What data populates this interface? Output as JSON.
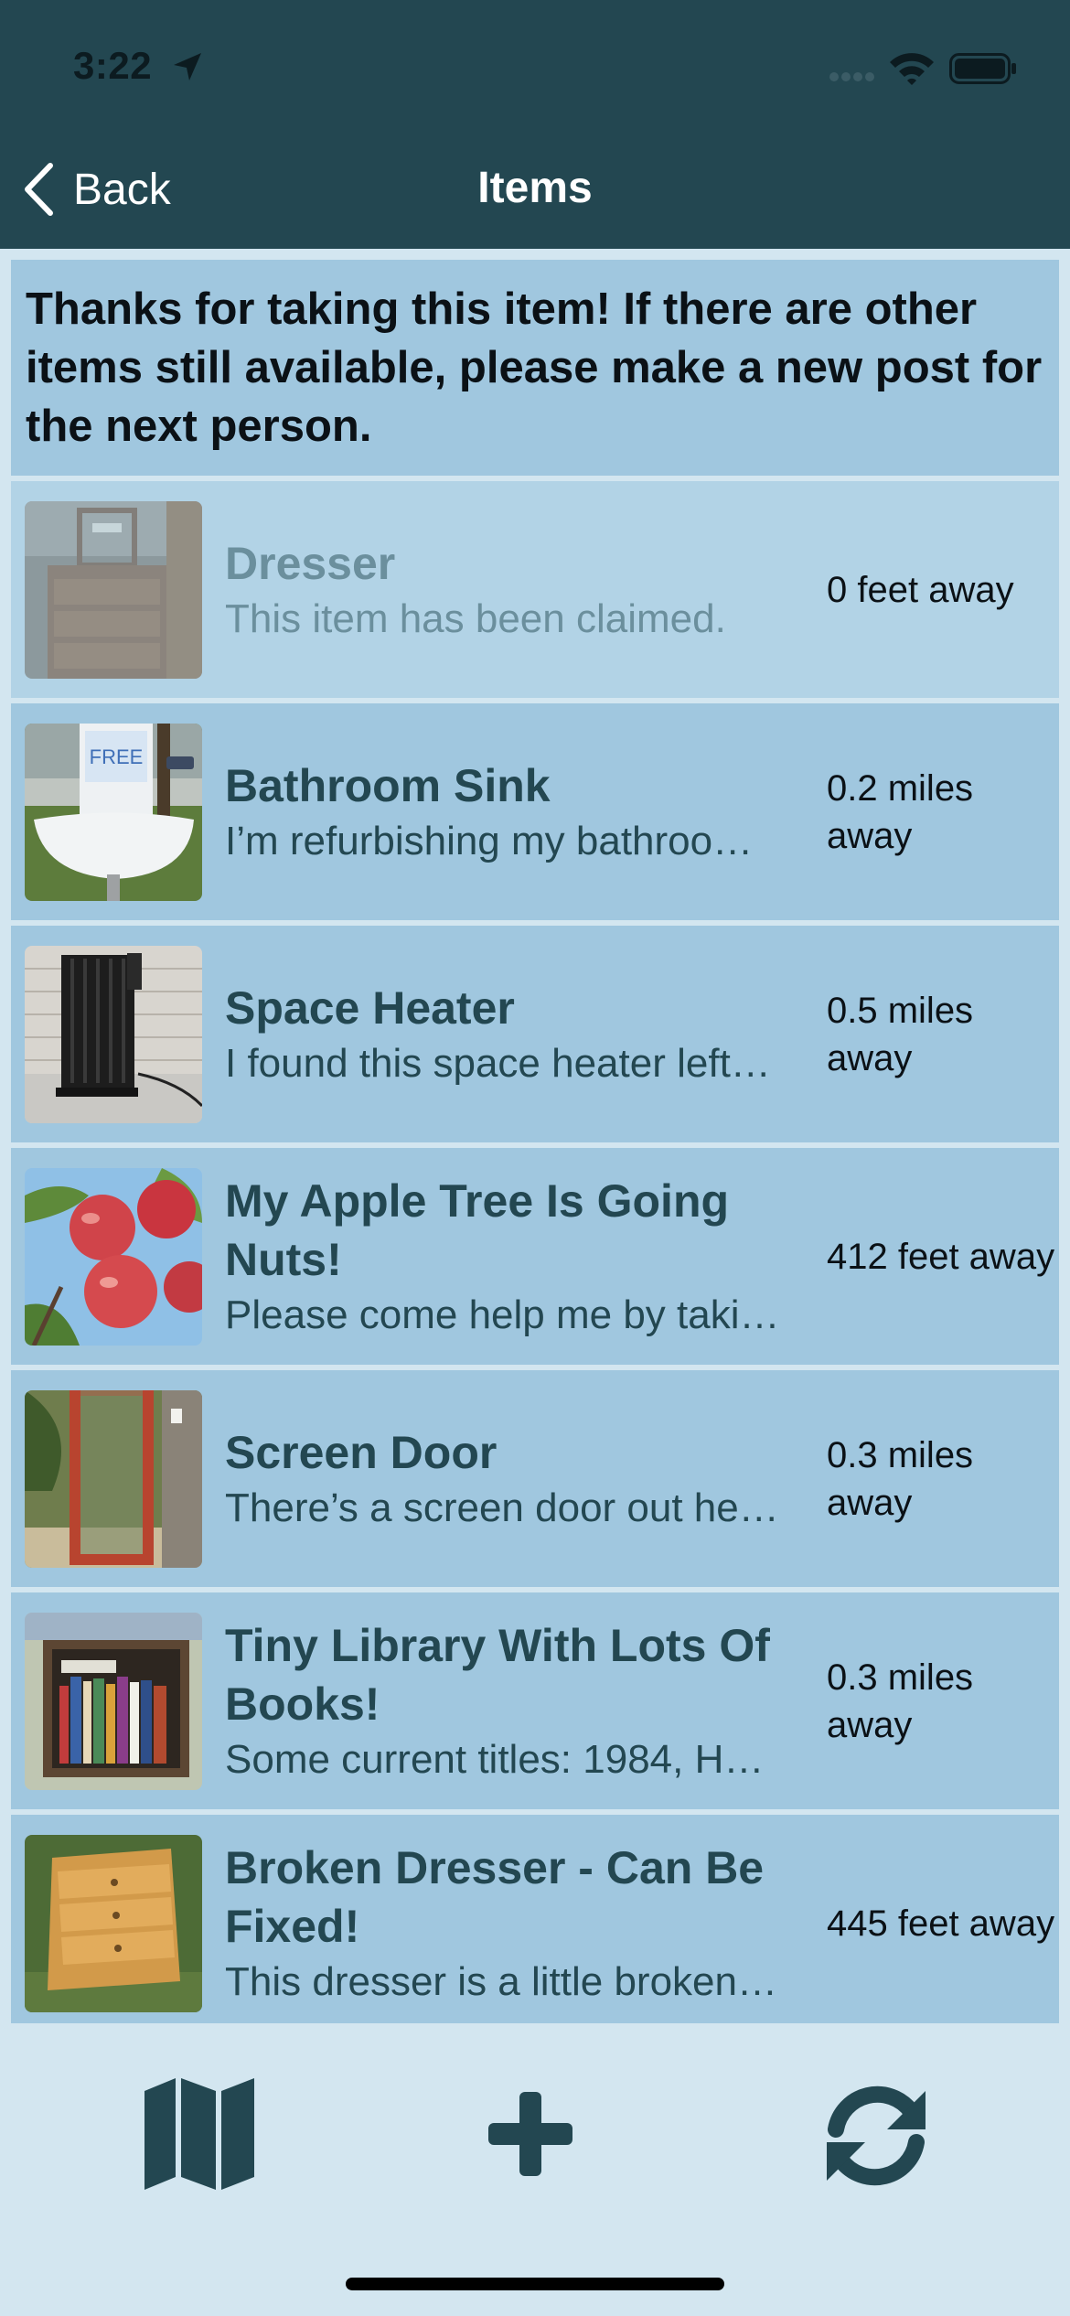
{
  "status_bar": {
    "time": "3:22"
  },
  "nav": {
    "back_label": "Back",
    "title": "Items"
  },
  "banner": "Thanks for taking this item! If there are other items still available, please make a new post for the next person.",
  "items": [
    {
      "title": "Dresser",
      "description": "This item has been claimed.",
      "distance": "0 feet away",
      "claimed": true,
      "image": "dresser"
    },
    {
      "title": "Bathroom Sink",
      "description": "I’m refurbishing my bathroo…",
      "distance": "0.2 miles away",
      "image": "sink"
    },
    {
      "title": "Space Heater",
      "description": "I found this space heater left…",
      "distance": "0.5 miles away",
      "image": "heater"
    },
    {
      "title": "My Apple Tree Is Going Nuts!",
      "description": "Please come help me by taki…",
      "distance": "412 feet away",
      "image": "apples"
    },
    {
      "title": "Screen Door",
      "description": "There’s a screen door out he…",
      "distance": "0.3 miles away",
      "image": "door"
    },
    {
      "title": "Tiny Library With Lots Of Books!",
      "description": "Some current titles: 1984, H…",
      "distance": "0.3 miles away",
      "image": "library"
    },
    {
      "title": "Broken Dresser - Can Be Fixed!",
      "description": "This dresser is a little broken…",
      "distance": "445 feet away",
      "image": "broken-dresser"
    }
  ],
  "thumb_sign": "FREE",
  "toolbar": {
    "icons": [
      "map-icon",
      "add-icon",
      "refresh-icon"
    ]
  },
  "colors": {
    "nav": "#234751",
    "row": "#a0c7df",
    "background": "#d3e6f0",
    "accent": "#234751"
  }
}
